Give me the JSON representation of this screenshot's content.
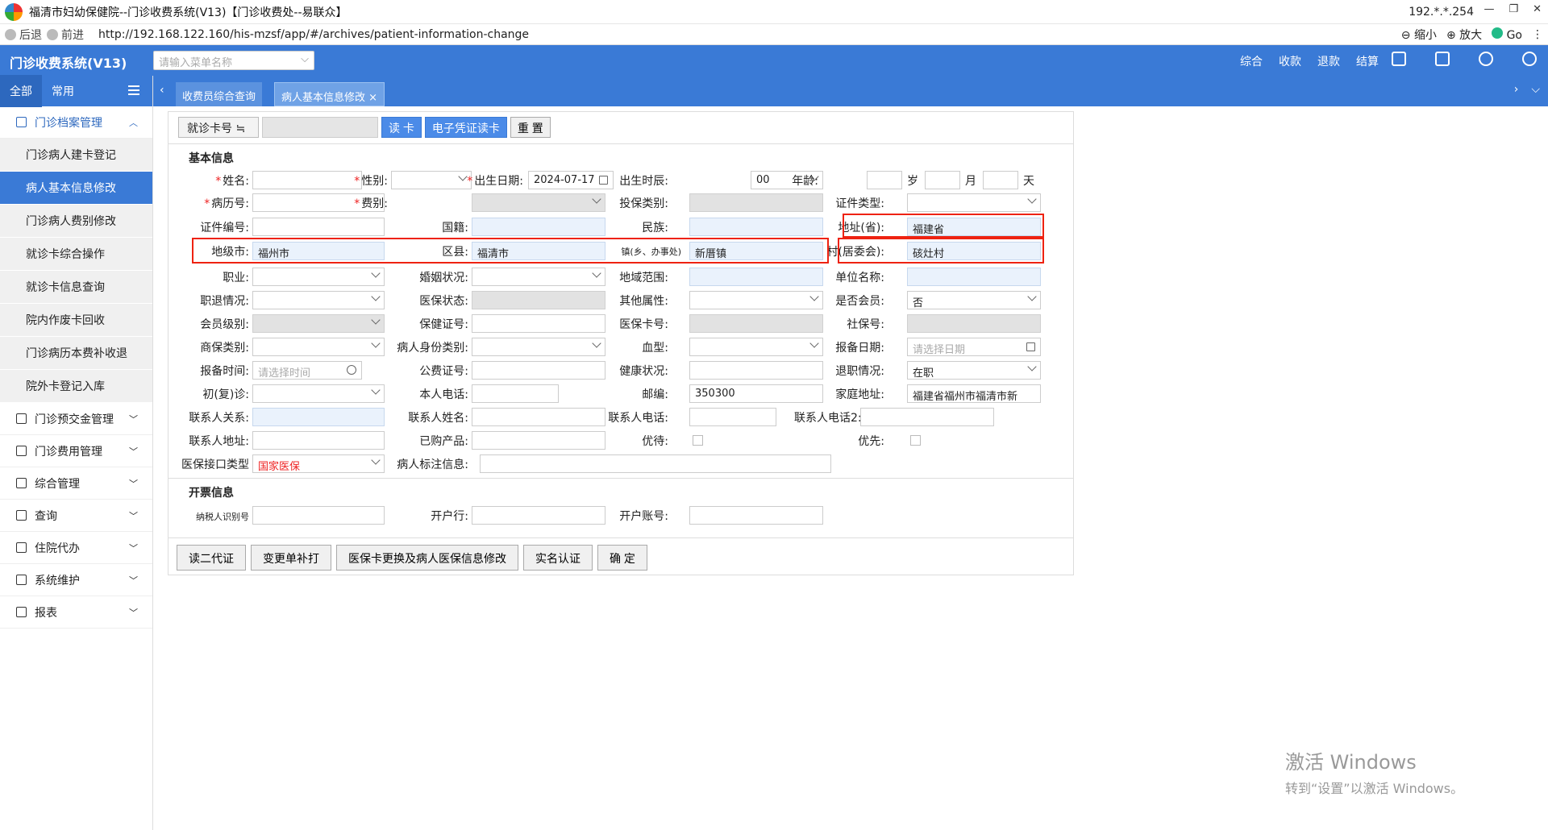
{
  "browser": {
    "title": "福清市妇幼保健院--门诊收费系统(V13)【门诊收费处--易联众】",
    "ip": "192.*.*.254",
    "back": "后退",
    "forward": "前进",
    "url": "http://192.168.122.160/his-mzsf/app/#/archives/patient-information-change",
    "zoom_out": "缩小",
    "zoom_in": "放大",
    "go": "Go"
  },
  "header": {
    "app_title": "门诊收费系统(V13)",
    "menu_search_placeholder": "请输入菜单名称",
    "links": [
      "综合",
      "收款",
      "退款",
      "结算"
    ]
  },
  "sidebar": {
    "tabs": [
      "全部",
      "常用"
    ],
    "groups": [
      {
        "label": "门诊档案管理",
        "open": true
      },
      {
        "label": "门诊预交金管理"
      },
      {
        "label": "门诊费用管理"
      },
      {
        "label": "综合管理"
      },
      {
        "label": "查询"
      },
      {
        "label": "住院代办"
      },
      {
        "label": "系统维护"
      },
      {
        "label": "报表"
      }
    ],
    "items": [
      "门诊病人建卡登记",
      "病人基本信息修改",
      "门诊病人费别修改",
      "就诊卡综合操作",
      "就诊卡信息查询",
      "院内作废卡回收",
      "门诊病历本费补收退",
      "院外卡登记入库"
    ]
  },
  "tabs": [
    "收费员综合查询",
    "病人基本信息修改 ×"
  ],
  "card": {
    "label": "就诊卡号 ≒",
    "read_card": "读 卡",
    "e_card": "电子凭证读卡",
    "reset": "重 置"
  },
  "sections": {
    "basic": "基本信息",
    "invoice": "开票信息"
  },
  "labels": {
    "name": "姓名:",
    "gender": "性别:",
    "birth": "出生日期:",
    "birth_hour": "出生时辰:",
    "age": "年龄:",
    "record_no": "病历号:",
    "fee_type": "费别:",
    "insurance_type": "投保类别:",
    "id_type": "证件类型:",
    "id_no": "证件编号:",
    "nationality": "国籍:",
    "ethnicity": "民族:",
    "province": "地址(省):",
    "city": "地级市:",
    "county": "区县:",
    "town": "镇(乡、办事处)",
    "village": "村(居委会):",
    "occupation": "职业:",
    "marital": "婚姻状况:",
    "region": "地域范围:",
    "employer": "单位名称:",
    "retire": "职退情况:",
    "ins_status": "医保状态:",
    "other_attr": "其他属性:",
    "member": "是否会员:",
    "member_level": "会员级别:",
    "health_cert": "保健证号:",
    "ins_card": "医保卡号:",
    "social_no": "社保号:",
    "commercial": "商保类别:",
    "patient_id_type": "病人身份类别:",
    "blood": "血型:",
    "filing_date": "报备日期:",
    "filing_time": "报备时间:",
    "public_cert": "公费证号:",
    "health_status": "健康状况:",
    "retire_status": "退职情况:",
    "visit": "初(复)诊:",
    "phone": "本人电话:",
    "postal": "邮编:",
    "home_addr": "家庭地址:",
    "contact_rel": "联系人关系:",
    "contact_name": "联系人姓名:",
    "contact_phone": "联系人电话:",
    "contact_phone2": "联系人电话2:",
    "contact_addr": "联系人地址:",
    "purchased": "已购产品:",
    "preferential": "优待:",
    "priority": "优先:",
    "ins_interface": "医保接口类型",
    "patient_mark": "病人标注信息:",
    "taxpayer_id": "纳税人识别号",
    "bank": "开户行:",
    "account": "开户账号:"
  },
  "units": {
    "year": "岁",
    "month": "月",
    "day": "天"
  },
  "values": {
    "birth": "2024-07-17",
    "birth_hour": "00",
    "province": "福建省",
    "city": "福州市",
    "county": "福清市",
    "town": "新厝镇",
    "village": "硋灶村",
    "member": "否",
    "retire_status": "在职",
    "postal": "350300",
    "home_addr": "福建省福州市福清市新",
    "ins_interface": "国家医保",
    "filing_date_ph": "请选择日期",
    "filing_time_ph": "请选择时间"
  },
  "buttons": [
    "读二代证",
    "变更单补打",
    "医保卡更换及病人医保信息修改",
    "实名认证",
    "确 定"
  ],
  "watermark": {
    "line1": "激活 Windows",
    "line2": "转到“设置”以激活 Windows。"
  }
}
